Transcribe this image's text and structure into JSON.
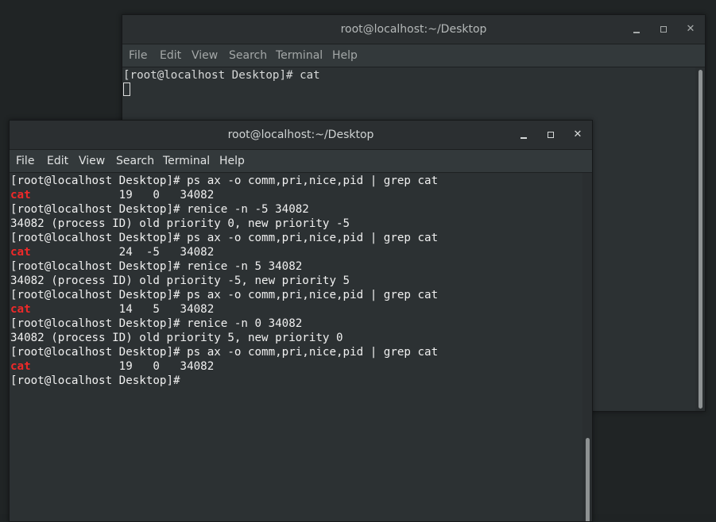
{
  "background_window": {
    "title": "root@localhost:~/Desktop",
    "menu": [
      "File",
      "Edit",
      "View",
      "Search",
      "Terminal",
      "Help"
    ],
    "lines": [
      "[root@localhost Desktop]# cat"
    ]
  },
  "foreground_window": {
    "title": "root@localhost:~/Desktop",
    "menu": [
      "File",
      "Edit",
      "View",
      "Search",
      "Terminal",
      "Help"
    ],
    "lines": [
      {
        "text": "[root@localhost Desktop]# ps ax -o comm,pri,nice,pid | grep cat"
      },
      {
        "hl": "cat",
        "text": "             19   0   34082"
      },
      {
        "text": "[root@localhost Desktop]# renice -n -5 34082"
      },
      {
        "text": "34082 (process ID) old priority 0, new priority -5"
      },
      {
        "text": "[root@localhost Desktop]# ps ax -o comm,pri,nice,pid | grep cat"
      },
      {
        "hl": "cat",
        "text": "             24  -5   34082"
      },
      {
        "text": "[root@localhost Desktop]# renice -n 5 34082"
      },
      {
        "text": "34082 (process ID) old priority -5, new priority 5"
      },
      {
        "text": "[root@localhost Desktop]# ps ax -o comm,pri,nice,pid | grep cat"
      },
      {
        "hl": "cat",
        "text": "             14   5   34082"
      },
      {
        "text": "[root@localhost Desktop]# renice -n 0 34082"
      },
      {
        "text": "34082 (process ID) old priority 5, new priority 0"
      },
      {
        "text": "[root@localhost Desktop]# ps ax -o comm,pri,nice,pid | grep cat"
      },
      {
        "hl": "cat",
        "text": "             19   0   34082"
      },
      {
        "text": "[root@localhost Desktop]# "
      }
    ]
  },
  "colors": {
    "terminal_bg": "#2c3133",
    "highlight": "#ef2929",
    "text": "#f0f0f0"
  },
  "icons": {
    "minimize": "minimize-icon",
    "maximize": "maximize-icon",
    "close": "close-icon"
  }
}
